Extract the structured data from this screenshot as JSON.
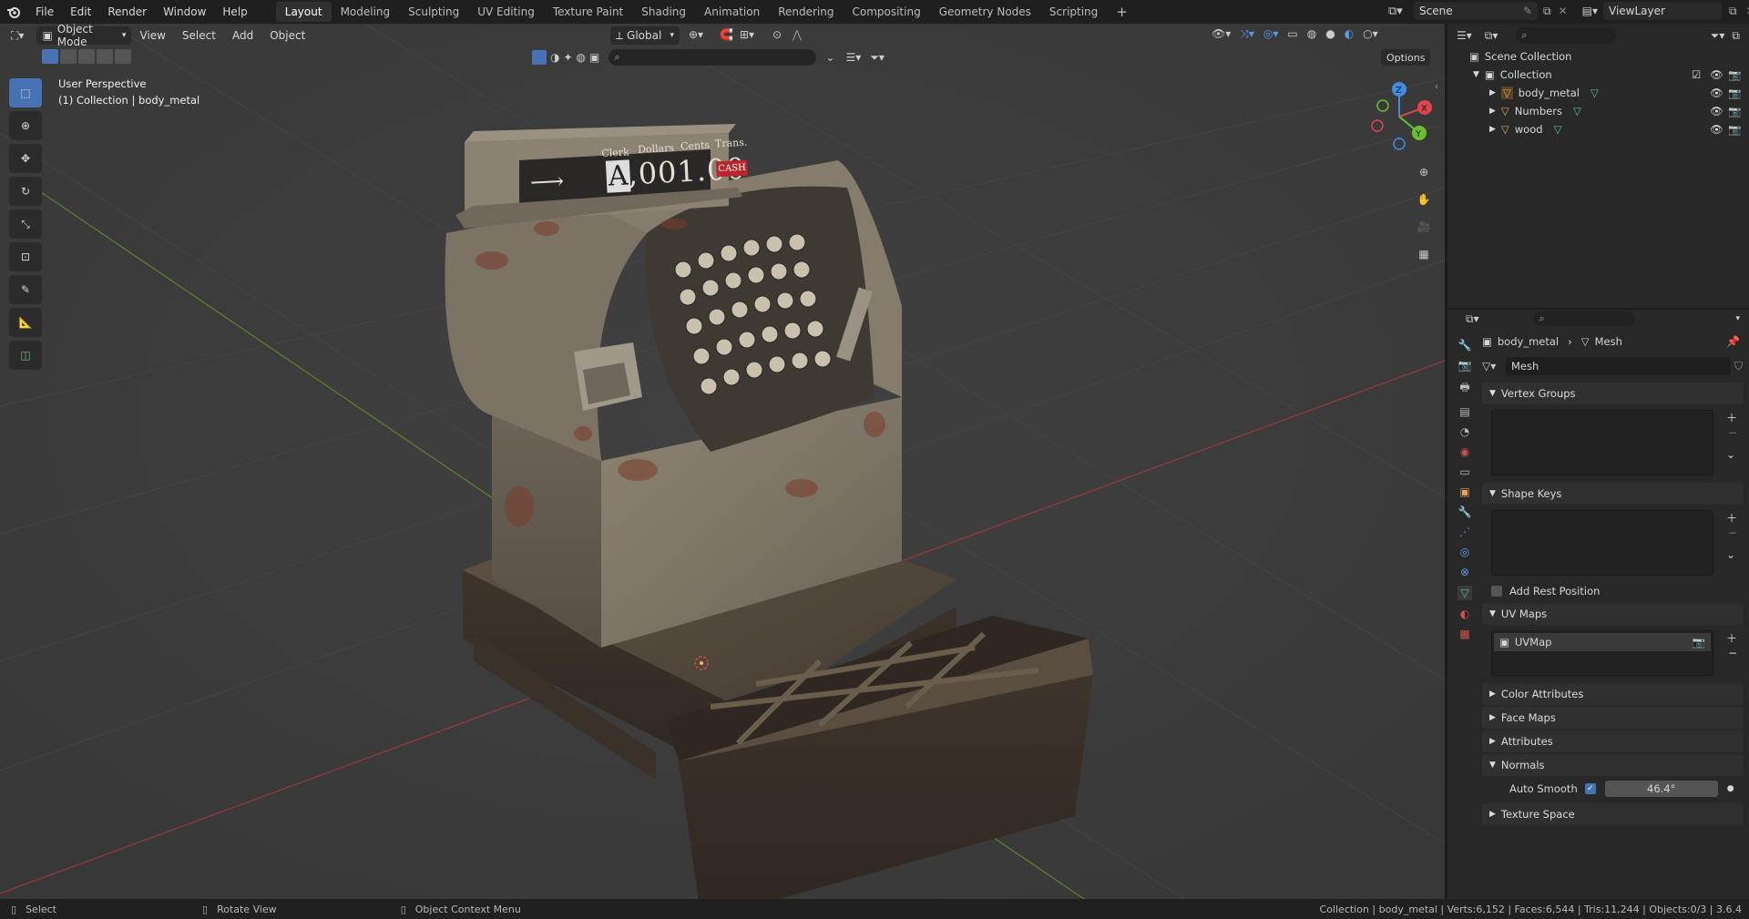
{
  "topbar": {
    "menus": [
      "File",
      "Edit",
      "Render",
      "Window",
      "Help"
    ],
    "workspaces": [
      "Layout",
      "Modeling",
      "Sculpting",
      "UV Editing",
      "Texture Paint",
      "Shading",
      "Animation",
      "Rendering",
      "Compositing",
      "Geometry Nodes",
      "Scripting"
    ],
    "active_workspace": "Layout",
    "add_tab": "+",
    "scene": "Scene",
    "view_layer": "ViewLayer"
  },
  "viewport_header": {
    "mode": "Object Mode",
    "menus": [
      "View",
      "Select",
      "Add",
      "Object"
    ],
    "transform_orientation": "Global",
    "options_label": "Options"
  },
  "overlay": {
    "perspective": "User Perspective",
    "collection_line": "(1) Collection | body_metal"
  },
  "gizmo": {
    "x": "X",
    "y": "Y",
    "z": "Z"
  },
  "model": {
    "clerk": "Clerk",
    "dollars": "Dollars",
    "cents": "Cents",
    "trans": "Trans.",
    "letter": "A",
    "amount": ",001.00",
    "cash": "CASH"
  },
  "outliner": {
    "scene_collection": "Scene Collection",
    "collection": "Collection",
    "items": [
      "body_metal",
      "Numbers",
      "wood"
    ]
  },
  "properties": {
    "breadcrumb_object": "body_metal",
    "breadcrumb_data": "Mesh",
    "mesh_name": "Mesh",
    "panels": {
      "vertex_groups": "Vertex Groups",
      "shape_keys": "Shape Keys",
      "add_rest_position": "Add Rest Position",
      "uv_maps": "UV Maps",
      "uv_map_item": "UVMap",
      "color_attributes": "Color Attributes",
      "face_maps": "Face Maps",
      "attributes": "Attributes",
      "normals": "Normals",
      "auto_smooth": "Auto Smooth",
      "auto_smooth_angle": "46.4°",
      "texture_space": "Texture Space"
    }
  },
  "statusbar": {
    "select": "Select",
    "rotate": "Rotate View",
    "context": "Object Context Menu",
    "stats": "Collection | body_metal | Verts:6,152 | Faces:6,544 | Tris:11,244 | Objects:0/3 | 3.6.4"
  },
  "colors": {
    "accent": "#4772b3",
    "x_axis": "#e0444e",
    "y_axis": "#6bbf2f",
    "z_axis": "#3e8ee8",
    "mesh_icon": "#4fc98e",
    "object_icon": "#e7a35a"
  }
}
